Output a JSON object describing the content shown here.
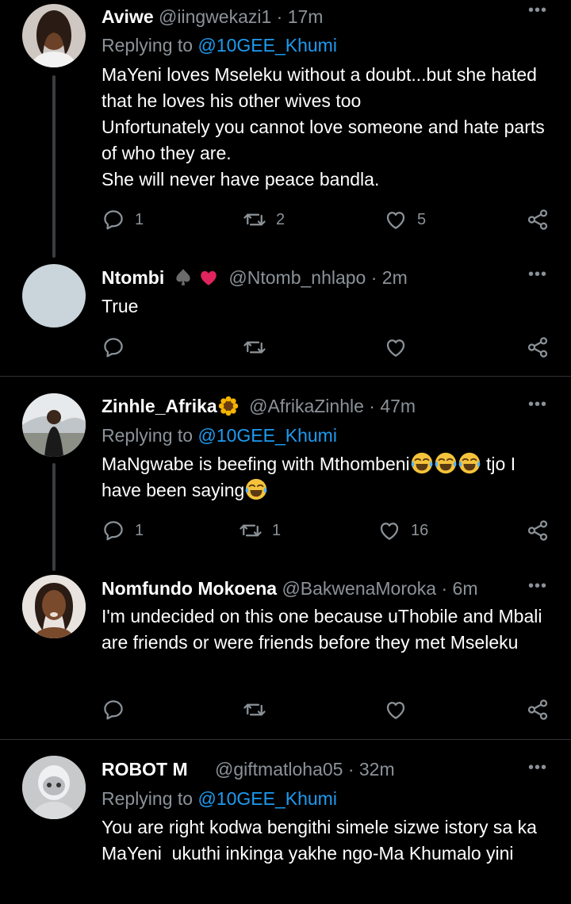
{
  "tweets": [
    {
      "name": "Aviwe",
      "handle": "@iingwekazi1",
      "time": "· 17m",
      "replying_prefix": "Replying to ",
      "replying_to": "@10GEE_Khumi",
      "body": "MaYeni loves Mseleku without a doubt...but she hated that he loves his other wives too\nUnfortunately you cannot love someone and hate parts of who they are.\nShe will never have peace bandla.",
      "replies": "1",
      "retweets": "2",
      "likes": "5"
    },
    {
      "name": "Ntombi",
      "handle": "@Ntomb_nhlapo",
      "time": "· 2m",
      "body": "True",
      "replies": "",
      "retweets": "",
      "likes": ""
    },
    {
      "name": "Zinhle_Afrika",
      "handle": "@AfrikaZinhle",
      "time": "· 47m",
      "replying_prefix": "Replying to ",
      "replying_to": "@10GEE_Khumi",
      "body_part1": "MaNgwabe is beefing with Mthombeni",
      "body_part2": " tjo I",
      "body_part3": "have been saying",
      "replies": "1",
      "retweets": "1",
      "likes": "16"
    },
    {
      "name": "Nomfundo Mokoena",
      "handle": "@BakwenaMoroka",
      "time": "· 6m",
      "body": "I'm undecided on this one because uThobile and Mbali are friends or were friends before they met Mseleku",
      "replies": "",
      "retweets": "",
      "likes": ""
    },
    {
      "name": "ROBOT M",
      "handle": "@giftmatloha05",
      "time": "· 32m",
      "replying_prefix": "Replying to ",
      "replying_to": "@10GEE_Khumi",
      "body": "You are right kodwa bengithi simele sizwe istory sa ka MaYeni  ukuthi inkinga yakhe ngo-Ma Khumalo yini"
    }
  ],
  "icons": {
    "reply": "reply-icon",
    "retweet": "retweet-icon",
    "like": "heart-icon",
    "share": "share-icon",
    "more": "more-icon"
  },
  "colors": {
    "background": "#000000",
    "secondary_text": "#8b9298",
    "link": "#1d9bf0",
    "heart_emoji": "#e0245e"
  }
}
